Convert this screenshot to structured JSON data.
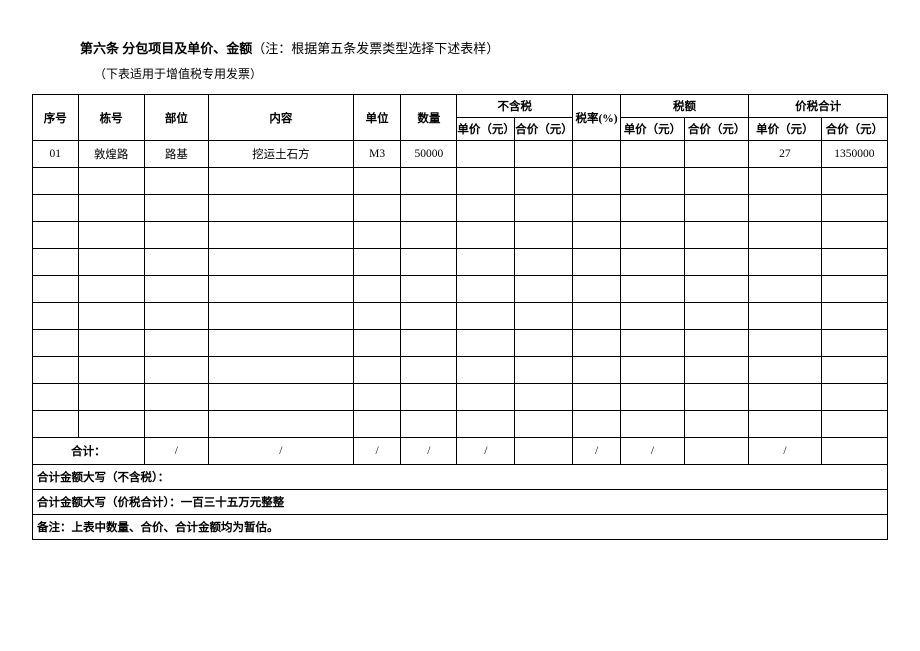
{
  "heading": {
    "clause": "第六条 分包项目及单价、金额",
    "note": "（注：根据第五条发票类型选择下述表样）",
    "subtitle": "（下表适用于增值税专用发票）"
  },
  "headers": {
    "seq": "序号",
    "building": "栋号",
    "part": "部位",
    "content": "内容",
    "unit": "单位",
    "qty": "数量",
    "excl_tax": "不含税",
    "tax_rate": "税率(%)",
    "tax_amount": "税额",
    "incl_tax": "价税合计",
    "unit_price": "单价（元）",
    "total_price": "合价（元）"
  },
  "rows": {
    "r0": {
      "seq": "01",
      "building": "敦煌路",
      "part": "路基",
      "content": "挖运土石方",
      "unit": "M3",
      "qty": "50000",
      "excl_unit": "",
      "excl_total": "",
      "rate": "",
      "tax_unit": "",
      "tax_total": "",
      "incl_unit": "27",
      "incl_total": "1350000"
    }
  },
  "sum": {
    "label": "合计：",
    "slash": "/"
  },
  "footer": {
    "excl_words": "合计金额大写（不含税）：",
    "incl_words": "合计金额大写（价税合计）：一百三十五万元整整",
    "remark": "备注：上表中数量、合价、合计金额均为暂估。"
  }
}
